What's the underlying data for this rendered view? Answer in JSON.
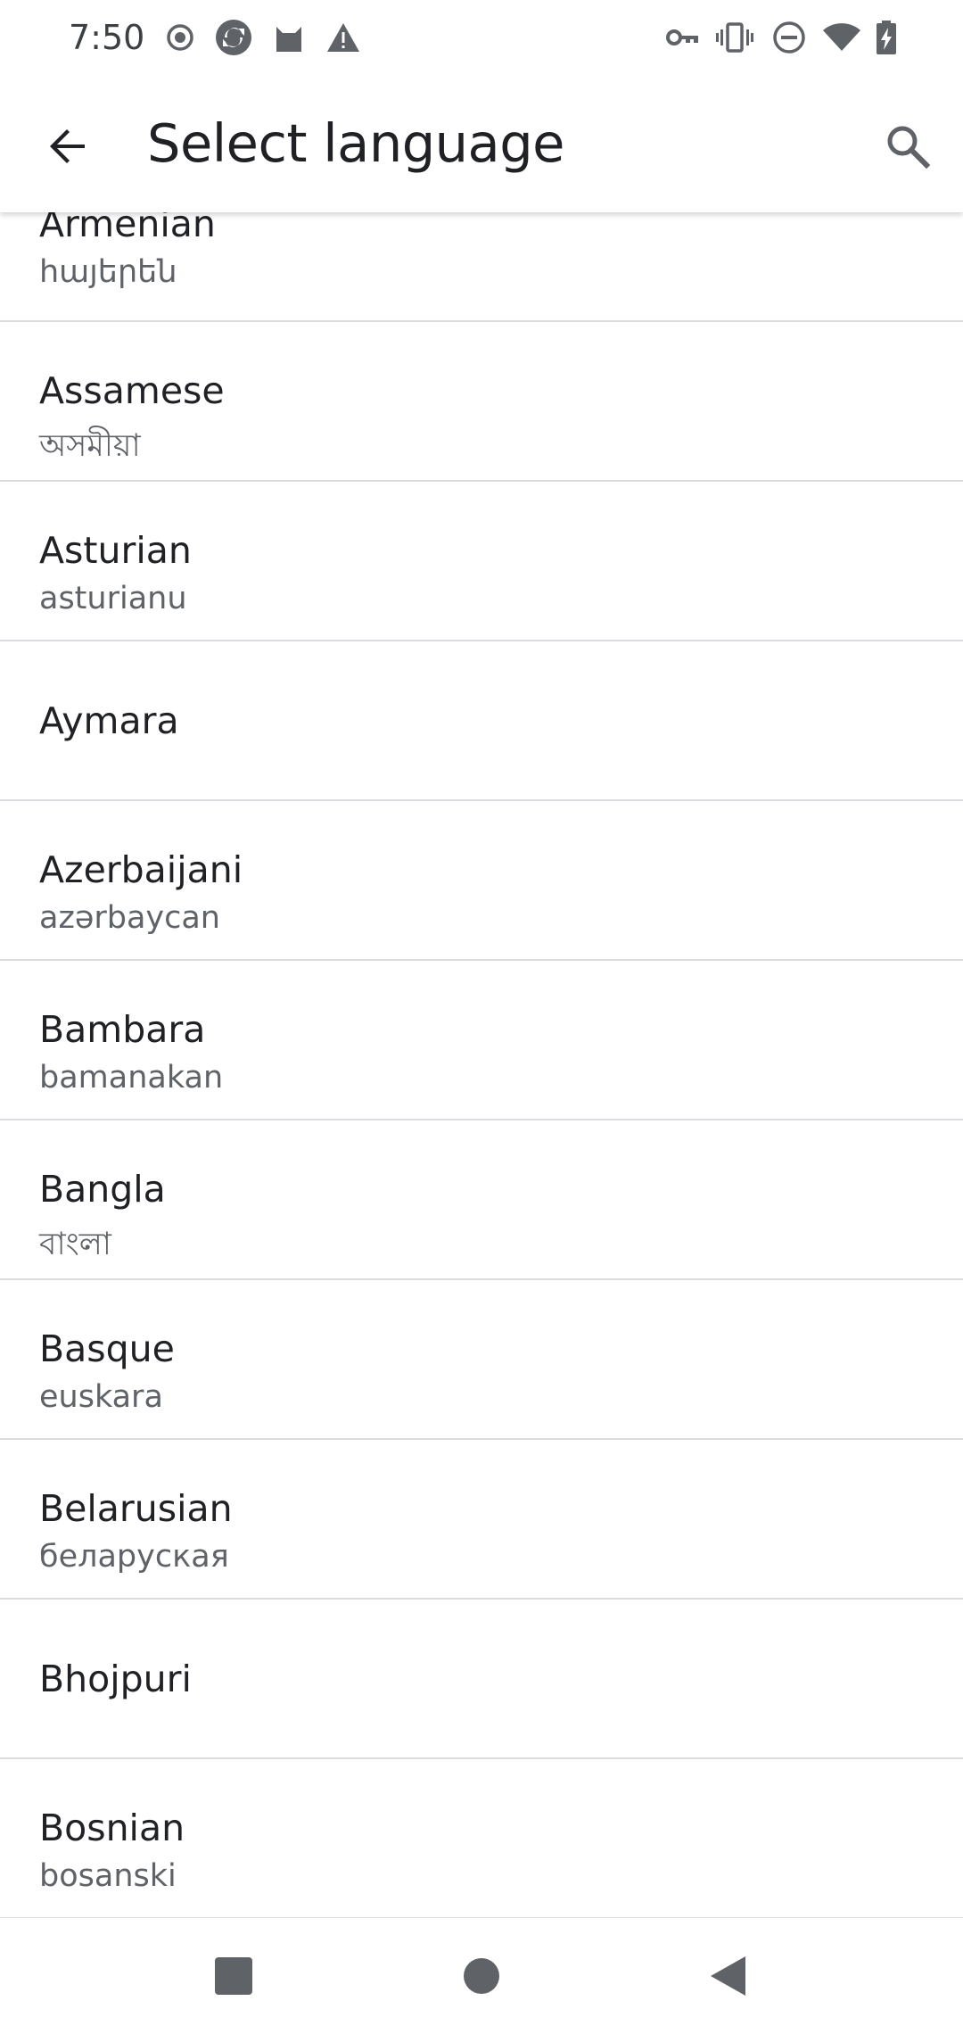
{
  "status_bar": {
    "time": "7:50",
    "left_icons": [
      "record-icon",
      "sync-app-icon",
      "cat-app-icon",
      "warning-icon"
    ],
    "right_icons": [
      "vpn-key-icon",
      "vibrate-icon",
      "do-not-disturb-icon",
      "wifi-icon",
      "battery-charging-icon"
    ]
  },
  "app_bar": {
    "title": "Select language",
    "back_icon": "arrow-back-icon",
    "search_icon": "search-icon"
  },
  "languages": [
    {
      "name": "Armenian",
      "native": "հայերեն"
    },
    {
      "name": "Assamese",
      "native": "অসমীয়া"
    },
    {
      "name": "Asturian",
      "native": "asturianu"
    },
    {
      "name": "Aymara",
      "native": ""
    },
    {
      "name": "Azerbaijani",
      "native": "azərbaycan"
    },
    {
      "name": "Bambara",
      "native": "bamanakan"
    },
    {
      "name": "Bangla",
      "native": "বাংলা"
    },
    {
      "name": "Basque",
      "native": "euskara"
    },
    {
      "name": "Belarusian",
      "native": "беларуская"
    },
    {
      "name": "Bhojpuri",
      "native": ""
    },
    {
      "name": "Bosnian",
      "native": "bosanski"
    }
  ],
  "nav_bar": {
    "recents_icon": "recents-square-icon",
    "home_icon": "home-circle-icon",
    "back_icon": "back-triangle-icon"
  },
  "colors": {
    "text_primary": "#202124",
    "text_secondary": "#5f6368",
    "divider": "#dadce0",
    "icon": "#5f6368"
  }
}
